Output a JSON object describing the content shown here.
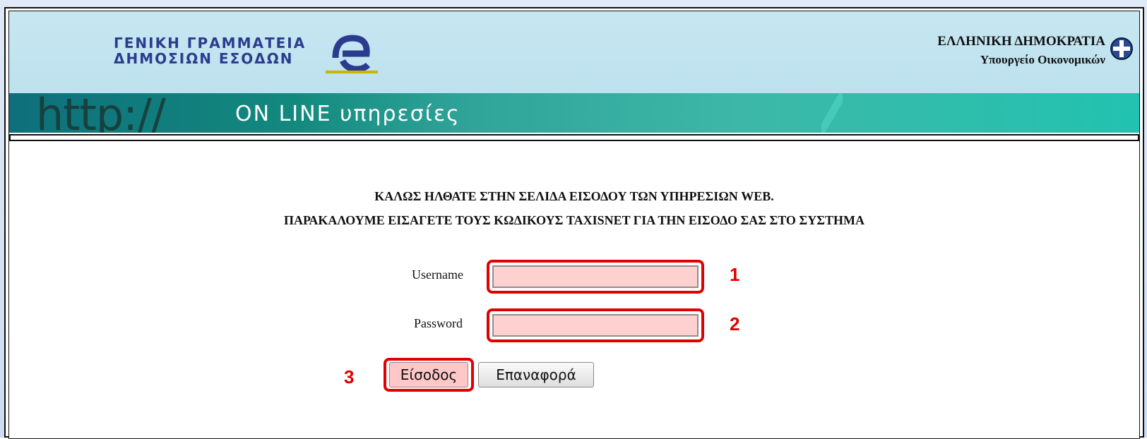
{
  "header": {
    "org_line1": "ΓΕΝΙΚΗ ΓΡΑΜΜΑΤΕΙΑ",
    "org_line2": "ΔΗΜΟΣΙΩΝ ΕΣΟΔΩΝ",
    "gov_title": "ΕΛΛΗΝΙΚΗ ΔΗΜΟΚΡΑΤΙΑ",
    "gov_sub": "Υπουργείο Οικονομικών",
    "banner_http": "http://",
    "banner_online": "ON LINE υπηρεσίες"
  },
  "welcome": {
    "line1": "ΚΑΛΩΣ ΗΛΘΑΤΕ ΣΤΗΝ ΣΕΛΙΔΑ ΕΙΣΟΔΟΥ ΤΩΝ ΥΠΗΡΕΣΙΩΝ WEB.",
    "line2": "ΠΑΡΑΚΑΛΟΥΜΕ ΕΙΣΑΓΕΤΕ ΤΟΥΣ ΚΩΔΙΚΟΥΣ TAXISNET ΓΙΑ ΤΗΝ ΕΙΣΟΔΟ ΣΑΣ ΣΤΟ ΣΥΣΤΗΜΑ"
  },
  "form": {
    "username_label": "Username",
    "password_label": "Password",
    "username_value": "",
    "password_value": "",
    "login_button": "Είσοδος",
    "reset_button": "Επαναφορά"
  },
  "annotations": {
    "marker1": "1",
    "marker2": "2",
    "marker3": "3"
  },
  "colors": {
    "header_bg": "#c2e4f0",
    "banner_teal": "#1aa394",
    "highlight_red": "#e10000",
    "input_fill": "#ffd0d0"
  }
}
